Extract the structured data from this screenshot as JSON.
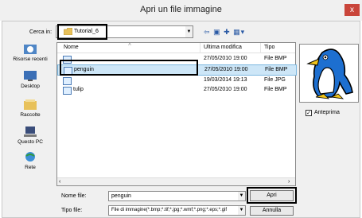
{
  "dialog": {
    "title": "Apri un file immagine",
    "close": "x"
  },
  "look_in": {
    "label": "Cerca in:",
    "value": "Tutorial_6"
  },
  "toolbar": {
    "icons": [
      "back-icon",
      "up-folder-icon",
      "new-folder-icon",
      "view-menu-icon"
    ]
  },
  "places": [
    {
      "label": "Risorse recenti",
      "icon": "recent-icon"
    },
    {
      "label": "Desktop",
      "icon": "desktop-icon"
    },
    {
      "label": "Raccolte",
      "icon": "libraries-icon"
    },
    {
      "label": "Questo PC",
      "icon": "computer-icon"
    },
    {
      "label": "Rete",
      "icon": "network-icon"
    }
  ],
  "columns": {
    "name": "Nome",
    "modified": "Ultima modifica",
    "type": "Tipo"
  },
  "files": [
    {
      "name": "",
      "modified": "27/05/2010 19:00",
      "type": "File BMP"
    },
    {
      "name": "penguin",
      "modified": "27/05/2010 19:00",
      "type": "File BMP"
    },
    {
      "name": "",
      "modified": "19/03/2014 19:13",
      "type": "File JPG"
    },
    {
      "name": "tulip",
      "modified": "27/05/2010 19:00",
      "type": "File BMP"
    }
  ],
  "preview": {
    "checkbox_label": "Anteprima",
    "checked": true
  },
  "file_name": {
    "label": "Nome file:",
    "value": "penguin"
  },
  "file_type": {
    "label": "Tipo file:",
    "value": "File di immagine(*.bmp;*.tif;*.jpg;*.wmf;*.png;*.eps;*.gif"
  },
  "buttons": {
    "open": "Apri",
    "cancel": "Annulla"
  }
}
